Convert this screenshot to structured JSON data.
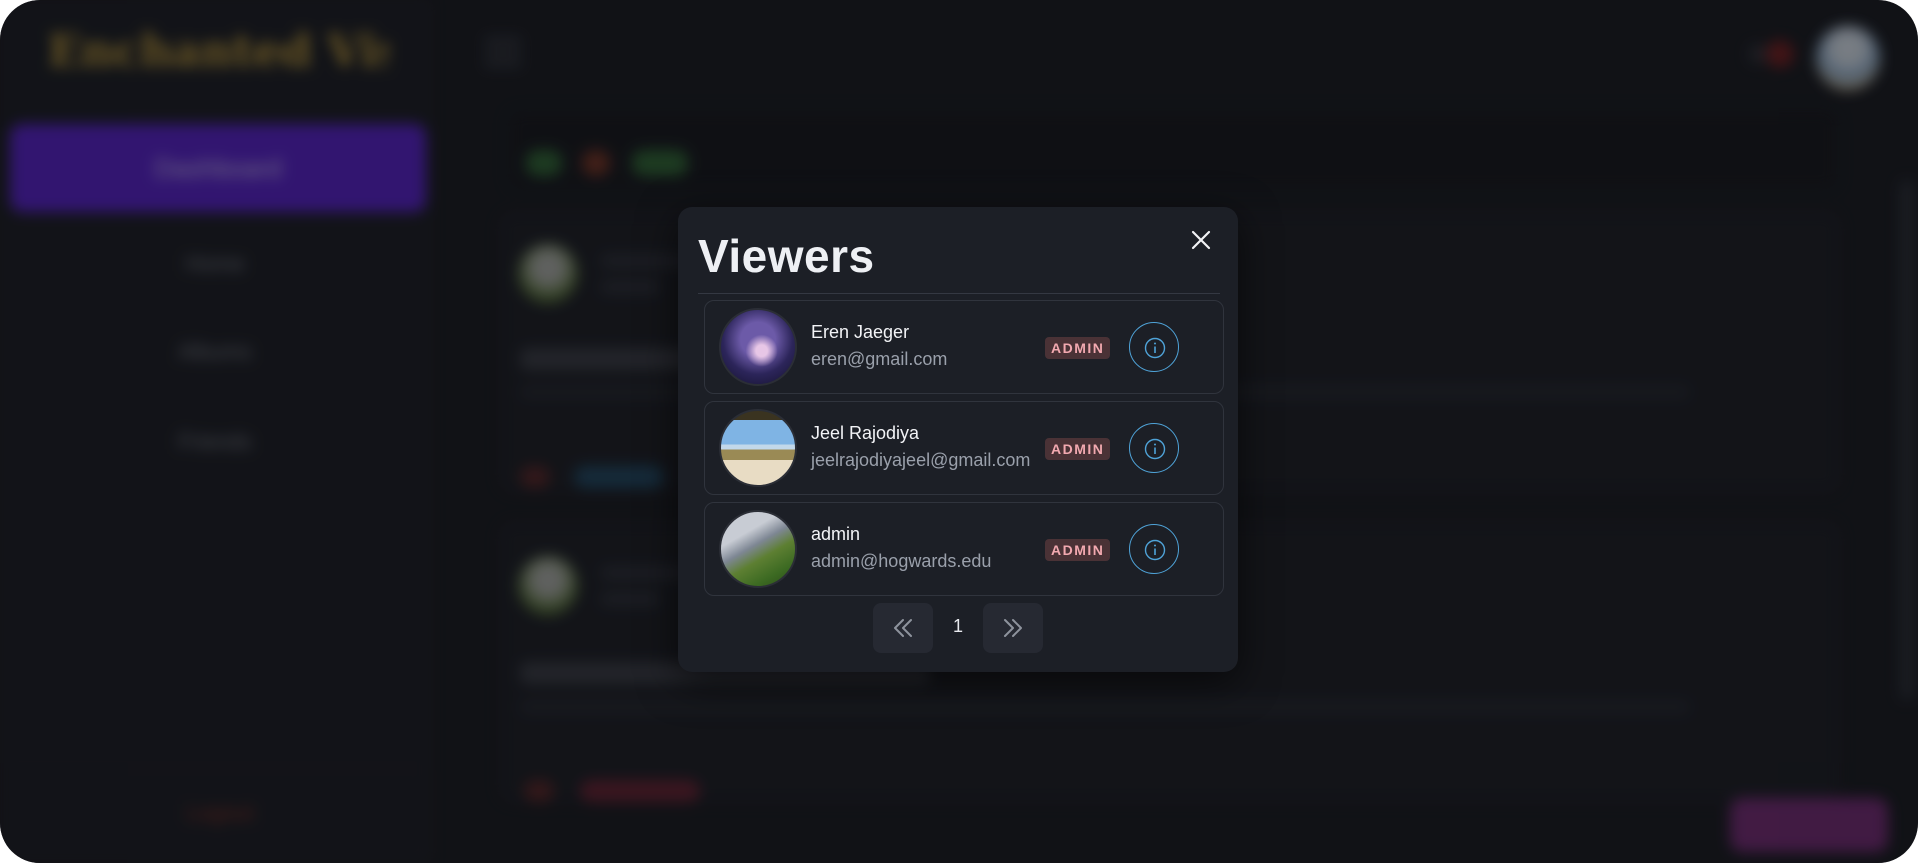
{
  "background": {
    "sidebar": {
      "logo_text": "Enchanted Vision",
      "active_item": "Dashboard",
      "items": [
        "Home",
        "Albums",
        "Friends"
      ],
      "logout_label": "Logout"
    }
  },
  "modal": {
    "title": "Viewers",
    "close_icon": "close-icon",
    "viewers": [
      {
        "name": "Eren Jaeger",
        "email": "eren@gmail.com",
        "role": "ADMIN"
      },
      {
        "name": "Jeel Rajodiya",
        "email": "jeelrajodiyajeel@gmail.com",
        "role": "ADMIN"
      },
      {
        "name": "admin",
        "email": "admin@hogwards.edu",
        "role": "ADMIN"
      }
    ],
    "pagination": {
      "current_page": "1",
      "prev_icon": "chevrons-left-icon",
      "next_icon": "chevrons-right-icon"
    }
  },
  "colors": {
    "modal_bg": "#1c1f26",
    "badge_bg": "#4a3236",
    "badge_text": "#f2a9b0",
    "info_accent": "#4fa3d8",
    "sidebar_active": "#5a1fd6"
  }
}
